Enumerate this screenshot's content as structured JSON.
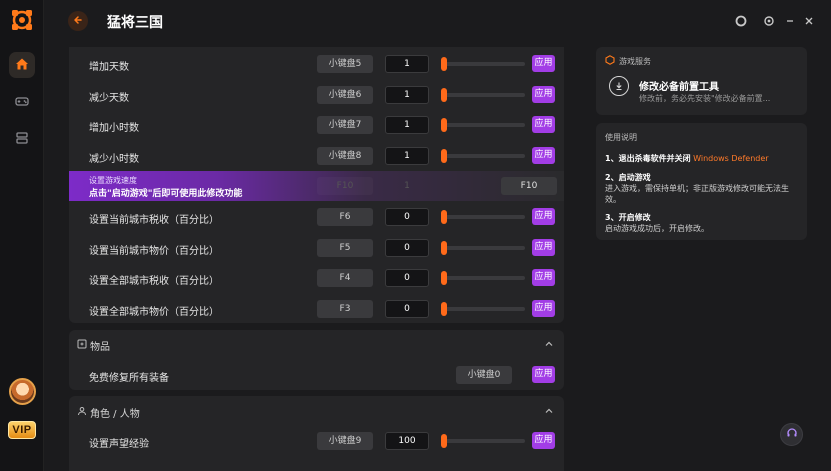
{
  "app": {
    "title": "猛将三国"
  },
  "sidebar": {
    "vip_label": "VIP"
  },
  "rows_top": [
    {
      "label": "增加天数",
      "key": "小键盘5",
      "value": "1",
      "apply": "应用",
      "fill": 0.0
    },
    {
      "label": "减少天数",
      "key": "小键盘6",
      "value": "1",
      "apply": "应用",
      "fill": 0.0
    },
    {
      "label": "增加小时数",
      "key": "小键盘7",
      "value": "1",
      "apply": "应用",
      "fill": 0.0
    },
    {
      "label": "减少小时数",
      "key": "小键盘8",
      "value": "1",
      "apply": "应用",
      "fill": 0.0
    }
  ],
  "speed_row": {
    "label": "设置游戏速度",
    "notice": "点击\"启动游戏\"后即可使用此修改功能",
    "ghost_key": "F10",
    "ghost_value": "1",
    "hotkey": "F10"
  },
  "rows_city": [
    {
      "label": "设置当前城市税收（百分比）",
      "key": "F6",
      "value": "0",
      "apply": "应用"
    },
    {
      "label": "设置当前城市物价（百分比）",
      "key": "F5",
      "value": "0",
      "apply": "应用"
    },
    {
      "label": "设置全部城市税收（百分比）",
      "key": "F4",
      "value": "0",
      "apply": "应用"
    },
    {
      "label": "设置全部城市物价（百分比）",
      "key": "F3",
      "value": "0",
      "apply": "应用"
    }
  ],
  "items_section": {
    "title": "物品",
    "row": {
      "label": "免费修复所有装备",
      "key": "小键盘0",
      "apply": "应用"
    }
  },
  "character_section": {
    "title": "角色 / 人物",
    "row": {
      "label": "设置声望经验",
      "key": "小键盘9",
      "value": "100",
      "apply": "应用"
    }
  },
  "game_service": {
    "title": "游戏服务",
    "tool_name": "修改必备前置工具",
    "tool_desc": "修改前，务必先安装\"修改必备前置..."
  },
  "instructions": {
    "title": "使用说明",
    "step1_title": "1、退出杀毒软件并关闭",
    "step1_highlight": "Windows Defender",
    "step2_title": "2、启动游戏",
    "step2_text": "进入游戏，需保持单机；非正版游戏修改可能无法生效。",
    "step3_title": "3、开启修改",
    "step3_text": "启动游戏成功后，开启修改。"
  },
  "colors": {
    "accent": "#ff6a1a",
    "apply": "#a23de6",
    "panel": "#252527",
    "bg": "#1b1b1d"
  }
}
